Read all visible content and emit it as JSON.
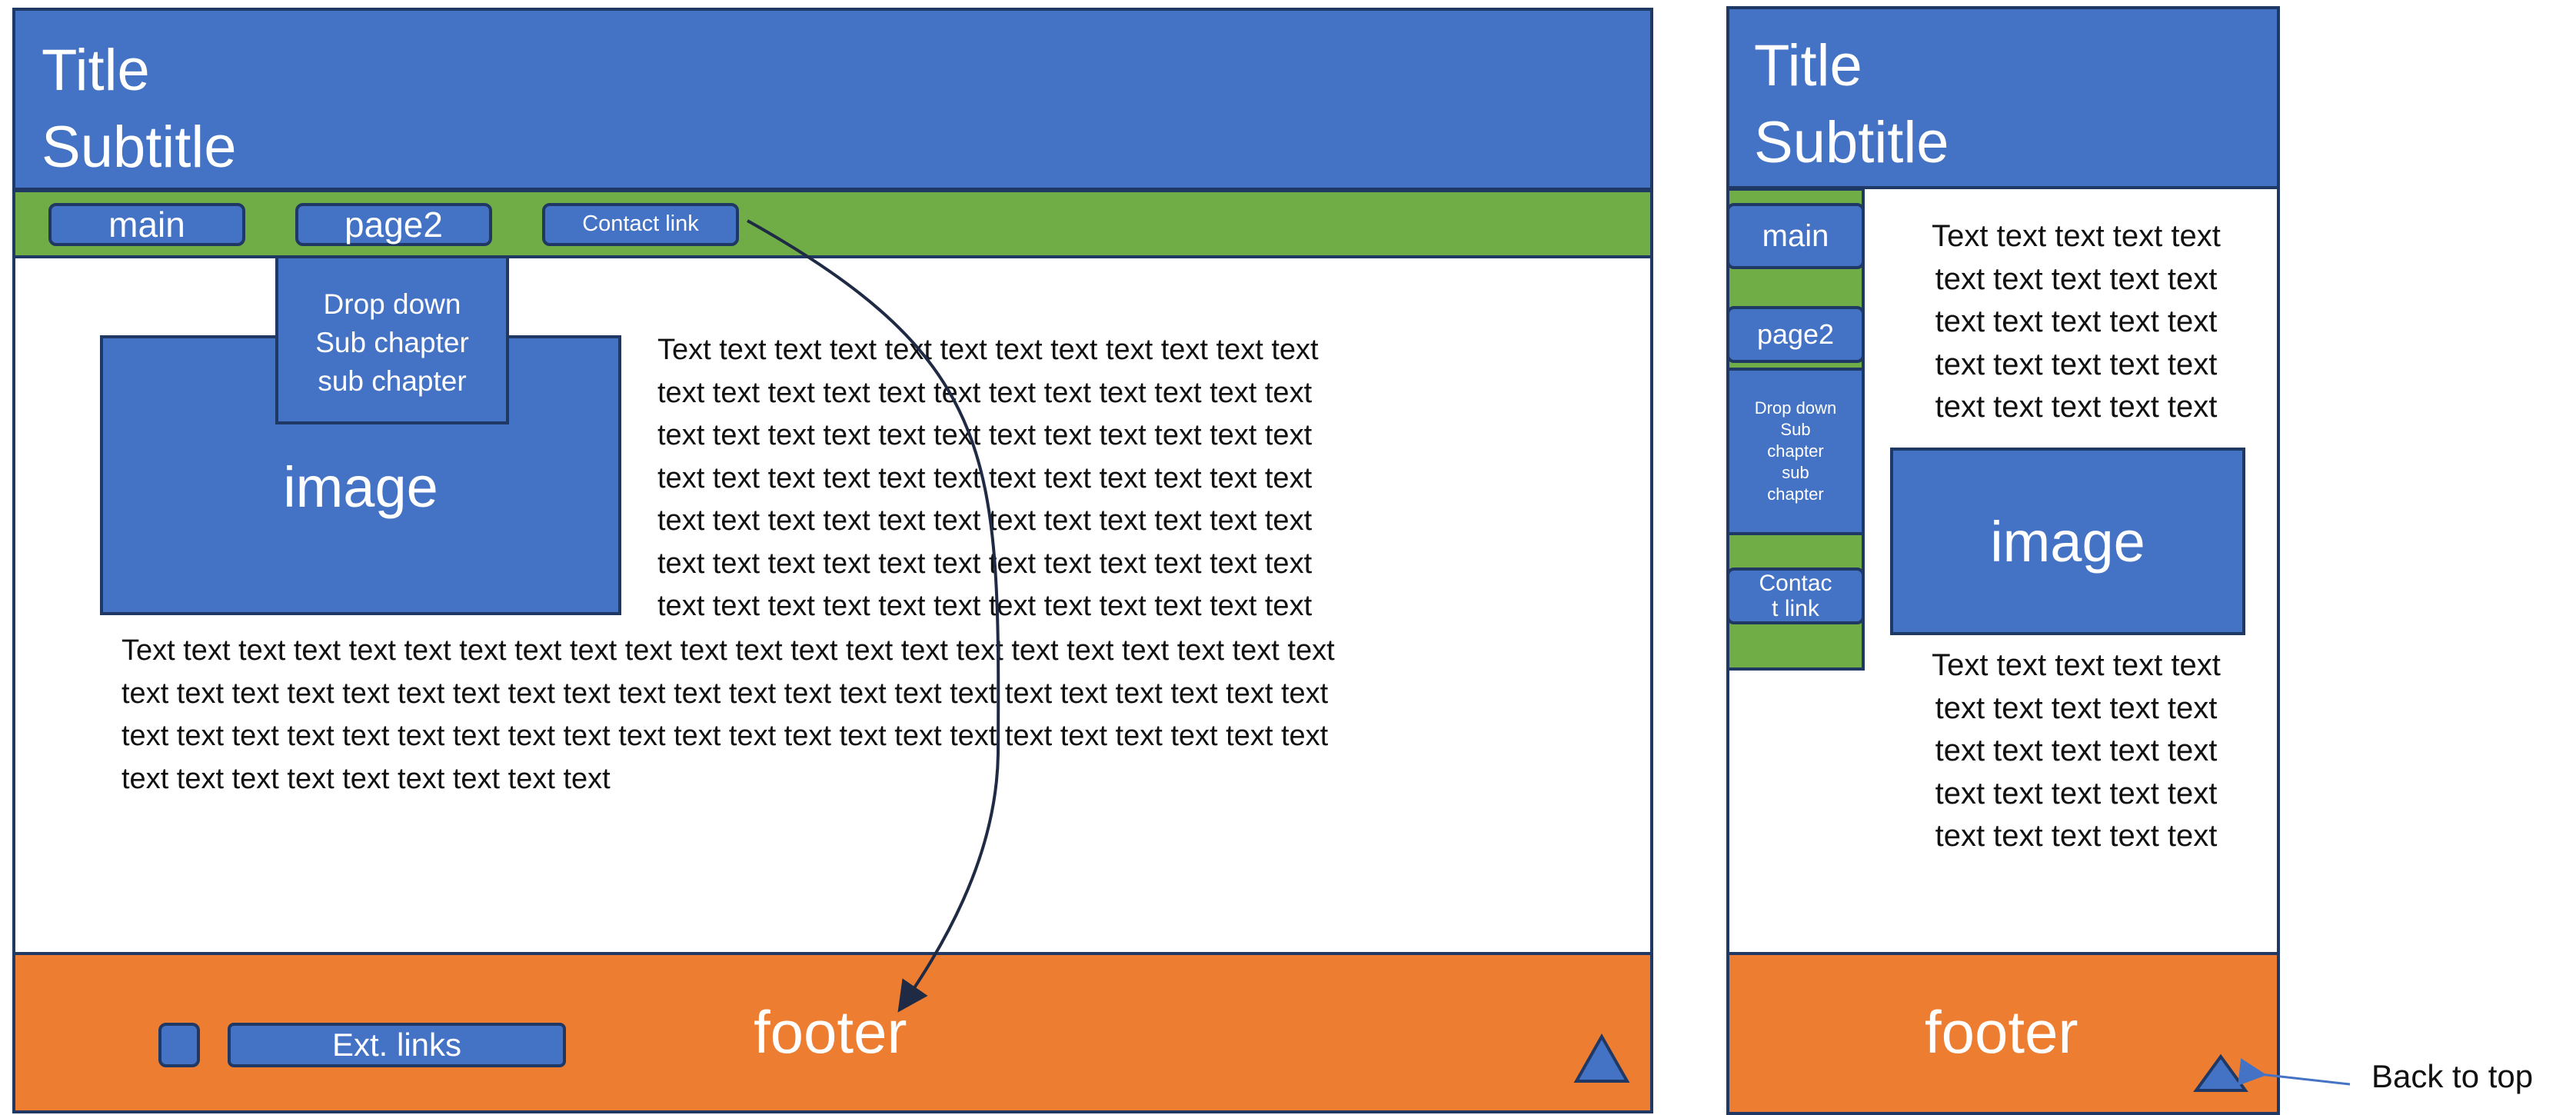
{
  "desktop": {
    "title": "Title",
    "subtitle": "Subtitle",
    "nav": {
      "main": "main",
      "page2": "page2",
      "contact": "Contact link"
    },
    "dropdown": {
      "line1": "Drop down",
      "line2": "Sub chapter",
      "line3": "sub chapter"
    },
    "image_label": "image",
    "text_right": "Text text text text text text text text text text text text\ntext text text text text text text text text text text text\ntext text text text text text text text text text text text\ntext text text text text text text text text text text text\ntext text text text text text text text text text text text\ntext text text text text text text text text text text text\ntext text text text text text text text text text text text",
    "text_full": "Text text text text text text text text text text text text text text text text text text text text text text\ntext text text text text text text text text text text text text text text text text text text text text text\ntext text text text text text text text text text text text text text text text text text text text text text\ntext text text text text text text text text",
    "footer_label": "footer",
    "ext_links": "Ext. links"
  },
  "mobile": {
    "title": "Title",
    "subtitle": "Subtitle",
    "nav": {
      "main": "main",
      "page2": "page2",
      "dropdown": "Drop down\nSub\nchapter\nsub\nchapter",
      "contact": "Contac\nt link"
    },
    "text_top": "Text text text text text\ntext text text text text\ntext text text text text\ntext text text text text\ntext text text text text",
    "image_label": "image",
    "text_bottom": "Text text text text text\ntext text text text text\ntext text text text text\ntext text text text text\ntext text text text text",
    "footer_label": "footer"
  },
  "annotation": {
    "back_to_top": "Back to top"
  },
  "colors": {
    "header": "#4472c4",
    "nav": "#70ad47",
    "footer": "#ed7d31",
    "outline": "#1f3864"
  }
}
